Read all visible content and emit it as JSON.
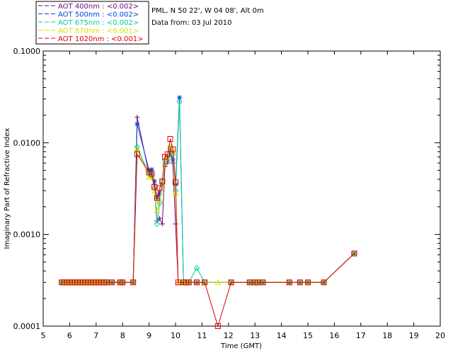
{
  "header": {
    "site": "PML, N 50 22', W 04 08', Alt 0m",
    "date_line": "Data from: 03 Jul 2010"
  },
  "chart_data": {
    "type": "line",
    "xlabel": "Time (GMT)",
    "ylabel": "Imaginary Part of Refractive Index",
    "xlim": [
      5,
      20
    ],
    "ylim": [
      0.0001,
      0.1
    ],
    "yscale": "log",
    "xticks": [
      "5",
      "6",
      "7",
      "8",
      "9",
      "10",
      "11",
      "12",
      "13",
      "14",
      "15",
      "16",
      "17",
      "18",
      "19",
      "20"
    ],
    "yticks": [
      "0.0001",
      "0.0010",
      "0.0100",
      "0.1000"
    ],
    "legend_position": "top-left",
    "series": [
      {
        "name": "AOT  400nm : <0.002>",
        "color": "#7a007a",
        "marker": "plus",
        "x": [
          5.7,
          5.8,
          5.9,
          6.0,
          6.1,
          6.2,
          6.3,
          6.4,
          6.5,
          6.6,
          6.7,
          6.8,
          6.9,
          7.0,
          7.1,
          7.2,
          7.3,
          7.4,
          7.6,
          7.9,
          8.0,
          8.4,
          8.55,
          9.0,
          9.1,
          9.2,
          9.3,
          9.4,
          9.5,
          9.6,
          9.7,
          9.8,
          9.9,
          10.0,
          10.1,
          10.3,
          10.4,
          10.5,
          10.8,
          11.1,
          12.1,
          12.8,
          13.0,
          13.1,
          13.3,
          14.3,
          14.7,
          15.0,
          15.6,
          16.75
        ],
        "y": [
          0.0003,
          0.0003,
          0.0003,
          0.0003,
          0.0003,
          0.0003,
          0.0003,
          0.0003,
          0.0003,
          0.0003,
          0.0003,
          0.0003,
          0.0003,
          0.0003,
          0.0003,
          0.0003,
          0.0003,
          0.0003,
          0.0003,
          0.0003,
          0.0003,
          0.0003,
          0.019,
          0.0045,
          0.0042,
          0.0035,
          0.0014,
          0.0015,
          0.0013,
          0.0055,
          0.006,
          0.008,
          0.006,
          0.0013,
          0.0003,
          0.0003,
          0.0003,
          0.0003,
          0.0003,
          0.0003,
          0.0003,
          0.0003,
          0.0003,
          0.0003,
          0.0003,
          0.0003,
          0.0003,
          0.0003,
          0.0003,
          0.00062
        ]
      },
      {
        "name": "AOT  500nm : <0.002>",
        "color": "#0044dd",
        "marker": "asterisk",
        "x": [
          5.7,
          5.8,
          5.9,
          6.0,
          6.1,
          6.2,
          6.3,
          6.4,
          6.5,
          6.6,
          6.7,
          6.8,
          6.9,
          7.0,
          7.1,
          7.2,
          7.3,
          7.4,
          7.6,
          7.9,
          8.0,
          8.4,
          8.55,
          9.0,
          9.1,
          9.2,
          9.3,
          9.4,
          9.5,
          9.6,
          9.7,
          9.8,
          9.9,
          10.0,
          10.15,
          10.3,
          10.4,
          10.5,
          10.8,
          11.1,
          12.1,
          12.8,
          13.0,
          13.1,
          13.3,
          14.3,
          14.7,
          15.0,
          15.6,
          16.75
        ],
        "y": [
          0.0003,
          0.0003,
          0.0003,
          0.0003,
          0.0003,
          0.0003,
          0.0003,
          0.0003,
          0.0003,
          0.0003,
          0.0003,
          0.0003,
          0.0003,
          0.0003,
          0.0003,
          0.0003,
          0.0003,
          0.0003,
          0.0003,
          0.0003,
          0.0003,
          0.0003,
          0.016,
          0.005,
          0.0051,
          0.0038,
          0.0025,
          0.0028,
          0.0035,
          0.006,
          0.0065,
          0.0085,
          0.0065,
          0.0035,
          0.031,
          0.0003,
          0.0003,
          0.0003,
          0.0003,
          0.0003,
          0.0003,
          0.0003,
          0.0003,
          0.0003,
          0.0003,
          0.0003,
          0.0003,
          0.0003,
          0.0003,
          0.00062
        ]
      },
      {
        "name": "AOT  675nm : <0.002>",
        "color": "#00cc99",
        "marker": "diamond",
        "x": [
          5.7,
          5.8,
          5.9,
          6.0,
          6.1,
          6.2,
          6.3,
          6.4,
          6.5,
          6.6,
          6.7,
          6.8,
          6.9,
          7.0,
          7.1,
          7.2,
          7.3,
          7.4,
          7.6,
          7.9,
          8.0,
          8.4,
          8.55,
          9.0,
          9.1,
          9.2,
          9.3,
          9.4,
          9.5,
          9.6,
          9.7,
          9.8,
          9.9,
          10.0,
          10.15,
          10.3,
          10.4,
          10.5,
          10.8,
          11.1,
          12.1,
          12.8,
          13.0,
          13.1,
          13.3,
          14.3,
          14.7,
          15.0,
          15.6,
          16.75
        ],
        "y": [
          0.0003,
          0.0003,
          0.0003,
          0.0003,
          0.0003,
          0.0003,
          0.0003,
          0.0003,
          0.0003,
          0.0003,
          0.0003,
          0.0003,
          0.0003,
          0.0003,
          0.0003,
          0.0003,
          0.0003,
          0.0003,
          0.0003,
          0.0003,
          0.0003,
          0.0003,
          0.009,
          0.0045,
          0.0046,
          0.0032,
          0.0013,
          0.0022,
          0.0038,
          0.0065,
          0.007,
          0.009,
          0.0075,
          0.003,
          0.028,
          0.0003,
          0.0003,
          0.0003,
          0.00043,
          0.0003,
          0.0003,
          0.0003,
          0.0003,
          0.0003,
          0.0003,
          0.0003,
          0.0003,
          0.0003,
          0.0003,
          0.00062
        ]
      },
      {
        "name": "AOT  870nm : <0.001>",
        "color": "#dddd00",
        "marker": "triangle",
        "x": [
          5.7,
          5.8,
          5.9,
          6.0,
          6.1,
          6.2,
          6.3,
          6.4,
          6.5,
          6.6,
          6.7,
          6.8,
          6.9,
          7.0,
          7.1,
          7.2,
          7.3,
          7.4,
          7.6,
          7.9,
          8.0,
          8.4,
          8.55,
          9.0,
          9.1,
          9.2,
          9.3,
          9.4,
          9.5,
          9.6,
          9.7,
          9.8,
          9.9,
          10.0,
          10.1,
          10.3,
          10.4,
          10.5,
          10.8,
          11.1,
          11.6,
          12.1,
          12.8,
          13.0,
          13.1,
          13.3,
          14.3,
          14.7,
          15.0,
          15.6,
          16.75
        ],
        "y": [
          0.0003,
          0.0003,
          0.0003,
          0.0003,
          0.0003,
          0.0003,
          0.0003,
          0.0003,
          0.0003,
          0.0003,
          0.0003,
          0.0003,
          0.0003,
          0.0003,
          0.0003,
          0.0003,
          0.0003,
          0.0003,
          0.0003,
          0.0003,
          0.0003,
          0.0003,
          0.0085,
          0.0042,
          0.0043,
          0.003,
          0.0018,
          0.0024,
          0.0036,
          0.006,
          0.0068,
          0.009,
          0.008,
          0.0028,
          0.0003,
          0.0003,
          0.0003,
          0.0003,
          0.0003,
          0.0003,
          0.0003,
          0.0003,
          0.0003,
          0.0003,
          0.0003,
          0.0003,
          0.0003,
          0.0003,
          0.0003,
          0.0003,
          0.00062
        ]
      },
      {
        "name": "AOT 1020nm : <0.001>",
        "color": "#dd0000",
        "marker": "square",
        "x": [
          5.7,
          5.8,
          5.9,
          6.0,
          6.1,
          6.2,
          6.3,
          6.4,
          6.5,
          6.6,
          6.7,
          6.8,
          6.9,
          7.0,
          7.1,
          7.2,
          7.3,
          7.4,
          7.6,
          7.9,
          8.0,
          8.4,
          8.55,
          9.0,
          9.1,
          9.2,
          9.3,
          9.4,
          9.5,
          9.6,
          9.7,
          9.8,
          9.9,
          10.0,
          10.1,
          10.3,
          10.4,
          10.5,
          10.8,
          11.1,
          11.6,
          12.1,
          12.8,
          13.0,
          13.1,
          13.3,
          14.3,
          14.7,
          15.0,
          15.6,
          16.75
        ],
        "y": [
          0.0003,
          0.0003,
          0.0003,
          0.0003,
          0.0003,
          0.0003,
          0.0003,
          0.0003,
          0.0003,
          0.0003,
          0.0003,
          0.0003,
          0.0003,
          0.0003,
          0.0003,
          0.0003,
          0.0003,
          0.0003,
          0.0003,
          0.0003,
          0.0003,
          0.0003,
          0.0075,
          0.0048,
          0.0046,
          0.0033,
          0.0025,
          0.0032,
          0.0038,
          0.007,
          0.0075,
          0.011,
          0.0085,
          0.0037,
          0.0003,
          0.0003,
          0.0003,
          0.0003,
          0.0003,
          0.0003,
          0.0001,
          0.0003,
          0.0003,
          0.0003,
          0.0003,
          0.0003,
          0.0003,
          0.0003,
          0.0003,
          0.0003,
          0.00062
        ]
      }
    ]
  }
}
